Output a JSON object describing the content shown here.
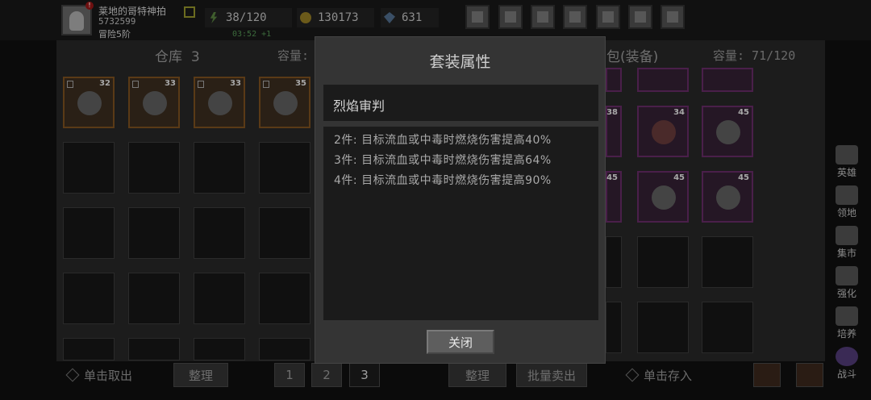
{
  "player": {
    "name": "莱地的哥特神拍",
    "id": "5732599",
    "rank": "冒险5阶"
  },
  "resources": {
    "stamina": "38/120",
    "stamina_timer": "03:52 +1",
    "gold": "130173",
    "gems": "631"
  },
  "warehouse": {
    "title": "仓库",
    "count": "3",
    "capacity_label": "容量:",
    "items": [
      {
        "level": "32"
      },
      {
        "level": "33"
      },
      {
        "level": "33"
      },
      {
        "level": "35"
      }
    ]
  },
  "bag": {
    "title": "包(装备)",
    "capacity": "容量: 71/120",
    "items": [
      {
        "level": "38"
      },
      {
        "level": "34"
      },
      {
        "level": "45"
      },
      {
        "level": "45"
      },
      {
        "level": "45"
      },
      {
        "level": "45"
      }
    ]
  },
  "bottom": {
    "take_out": "单击取出",
    "sort_left": "整理",
    "pages": [
      "1",
      "2",
      "3"
    ],
    "sort_right": "整理",
    "batch_sell": "批量卖出",
    "store": "单击存入"
  },
  "side_nav": [
    "英雄",
    "领地",
    "集市",
    "强化",
    "培养",
    "战斗"
  ],
  "modal": {
    "title": "套装属性",
    "set_name": "烈焰审判",
    "bonuses": [
      "2件: 目标流血或中毒时燃烧伤害提高40%",
      "3件: 目标流血或中毒时燃烧伤害提高64%",
      "4件: 目标流血或中毒时燃烧伤害提高90%"
    ],
    "close_label": "关闭"
  },
  "colors": {
    "modal_bg": "#343434",
    "inner_box": "#1b1b1b",
    "button": "#5e5e5e"
  }
}
